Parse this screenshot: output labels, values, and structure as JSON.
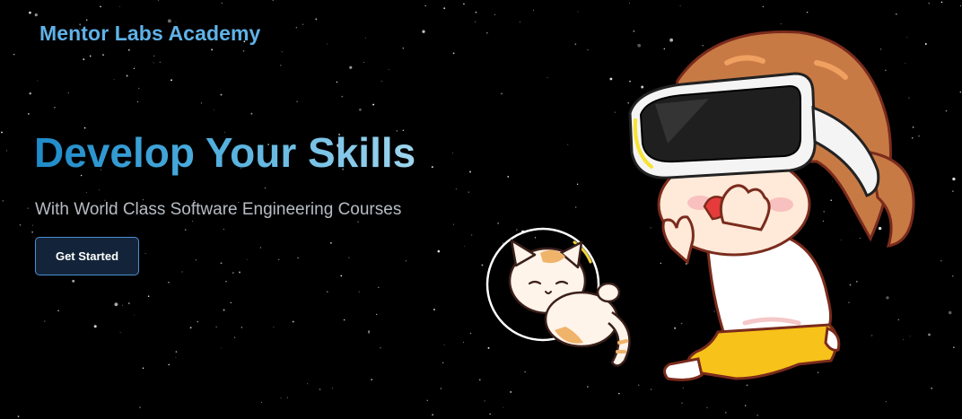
{
  "header": {
    "brand_name": "Mentor Labs Academy"
  },
  "hero": {
    "title": "Develop Your Skills",
    "subtitle": "With World Class Software Engineering Courses",
    "cta_label": "Get Started"
  },
  "colors": {
    "background": "#000000",
    "brand": "#5fb2e8",
    "title_gradient_start": "#1e8ac8",
    "title_gradient_end": "#9fd6ee",
    "subtitle": "#b6bcc3",
    "button_border": "#4d8fd1",
    "button_bg": "#13243a"
  },
  "illustration": {
    "subject": "girl-with-vr-headset-and-cat-in-space-helmet"
  }
}
